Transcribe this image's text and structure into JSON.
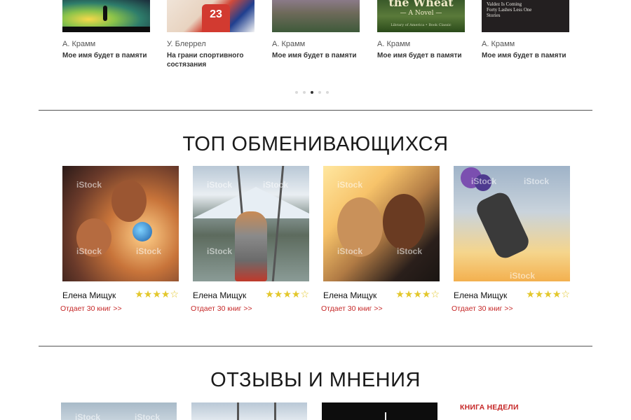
{
  "books": [
    {
      "author": "А. Крамм",
      "title": "Мое имя будет в памяти"
    },
    {
      "author": "У. Блеррел",
      "title": "На грани спортивного состязания",
      "cover_text": "23"
    },
    {
      "author": "А. Крамм",
      "title": "Мое имя будет в памяти"
    },
    {
      "author": "А. Крамм",
      "title": "Мое имя будет в памяти",
      "cover_text": [
        "the Wheat",
        "— A Novel —",
        "Library of America • Book Classic"
      ]
    },
    {
      "author": "А. Крамм",
      "title": "Мое имя будет в памяти",
      "cover_text": [
        "Valdez Is Coming",
        "Forty Lashes Less One",
        "Stories"
      ]
    }
  ],
  "carousel": {
    "pages": 5,
    "active_index": 2
  },
  "top_traders": {
    "title": "ТОП ОБМЕНИВАЮЩИХСЯ",
    "items": [
      {
        "name": "Елена Мищук",
        "stars": "★★★★☆",
        "rating": 4,
        "offer": "Отдает 30 книг >>"
      },
      {
        "name": "Елена Мищук",
        "stars": "★★★★☆",
        "rating": 4,
        "offer": "Отдает 30 книг >>"
      },
      {
        "name": "Елена Мищук",
        "stars": "★★★★☆",
        "rating": 4,
        "offer": "Отдает 30 книг >>"
      },
      {
        "name": "Елена Мищук",
        "stars": "★★★★☆",
        "rating": 4,
        "offer": "Отдает 30 книг >>"
      }
    ],
    "watermark": "iStock"
  },
  "reviews": {
    "title": "ОТЗЫВЫ И МНЕНИЯ",
    "book_of_week_label": "КНИГА НЕДЕЛИ"
  },
  "colors": {
    "accent_red": "#c62828",
    "star_gold": "#e3c72b",
    "divider": "#555555"
  }
}
